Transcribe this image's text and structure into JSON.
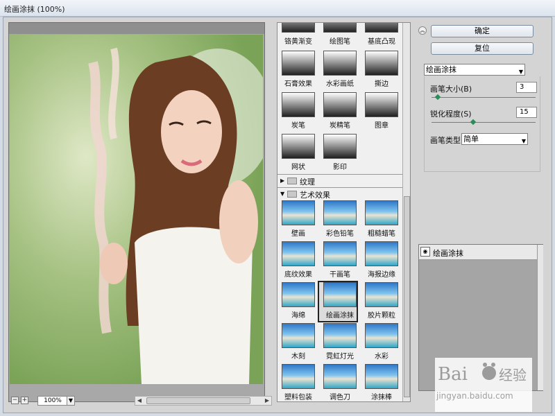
{
  "window": {
    "title": "绘画涂抹 (100%)"
  },
  "preview": {
    "zoom": "100%",
    "zoom_minus": "−",
    "zoom_plus": "+"
  },
  "gallery": {
    "top_row": [
      "铬黄渐变",
      "绘图笔",
      "基底凸现"
    ],
    "sketch": [
      [
        "石膏效果",
        "水彩画纸",
        "撕边"
      ],
      [
        "炭笔",
        "炭精笔",
        "图章"
      ],
      [
        "网状",
        "影印"
      ]
    ],
    "categories": {
      "texture": "纹理",
      "artistic": "艺术效果"
    },
    "artistic": [
      [
        "壁画",
        "彩色铅笔",
        "粗糙蜡笔"
      ],
      [
        "底纹效果",
        "干画笔",
        "海报边缘"
      ],
      [
        "海绵",
        "绘画涂抹",
        "胶片颗粒"
      ],
      [
        "木刻",
        "霓虹灯光",
        "水彩"
      ],
      [
        "塑料包装",
        "调色刀",
        "涂抹棒"
      ]
    ],
    "selected": "绘画涂抹"
  },
  "panel": {
    "ok": "确定",
    "reset": "复位",
    "filter": "绘画涂抹",
    "brush_size_label": "画笔大小(B)",
    "brush_size_value": "3",
    "brush_size_level": 0.06,
    "sharpness_label": "锐化程度(S)",
    "sharpness_value": "15",
    "sharpness_level": 0.4,
    "brush_type_label": "画笔类型(T):",
    "brush_type_value": "简单"
  },
  "layers": {
    "items": [
      "绘画涂抹"
    ]
  },
  "watermark": {
    "logo": "Baidu 经验",
    "url": "jingyan.baidu.com"
  },
  "colors": {
    "accent_knob": "#2d8c5a",
    "frame": "#d4d4d4"
  }
}
